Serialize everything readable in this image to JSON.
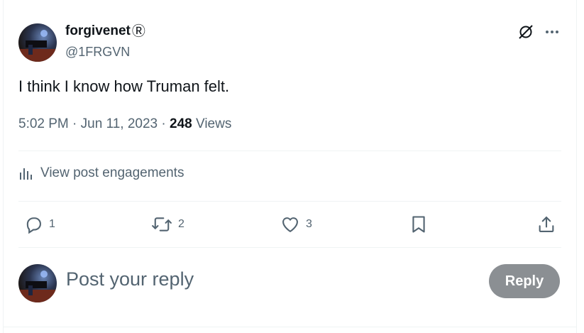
{
  "author": {
    "display_name": "forgivenet",
    "verified_mark": "Ⓡ",
    "handle": "@1FRGVN"
  },
  "post": {
    "text": "I think I know how Truman felt.",
    "time": "5:02 PM",
    "date": "Jun 11, 2023",
    "sep": "·",
    "views_count": "248",
    "views_label": "Views"
  },
  "engagements": {
    "label": "View post engagements"
  },
  "actions": {
    "reply_count": "1",
    "repost_count": "2",
    "like_count": "3"
  },
  "reply_box": {
    "placeholder": "Post your reply",
    "button_label": "Reply"
  },
  "colors": {
    "text": "#0f1419",
    "muted": "#536471",
    "divider": "#eff3f4",
    "reply_button": "#8b8f93"
  },
  "icons": [
    "grok-icon",
    "more-icon",
    "analytics-icon",
    "reply-icon",
    "repost-icon",
    "like-icon",
    "bookmark-icon",
    "share-icon"
  ]
}
